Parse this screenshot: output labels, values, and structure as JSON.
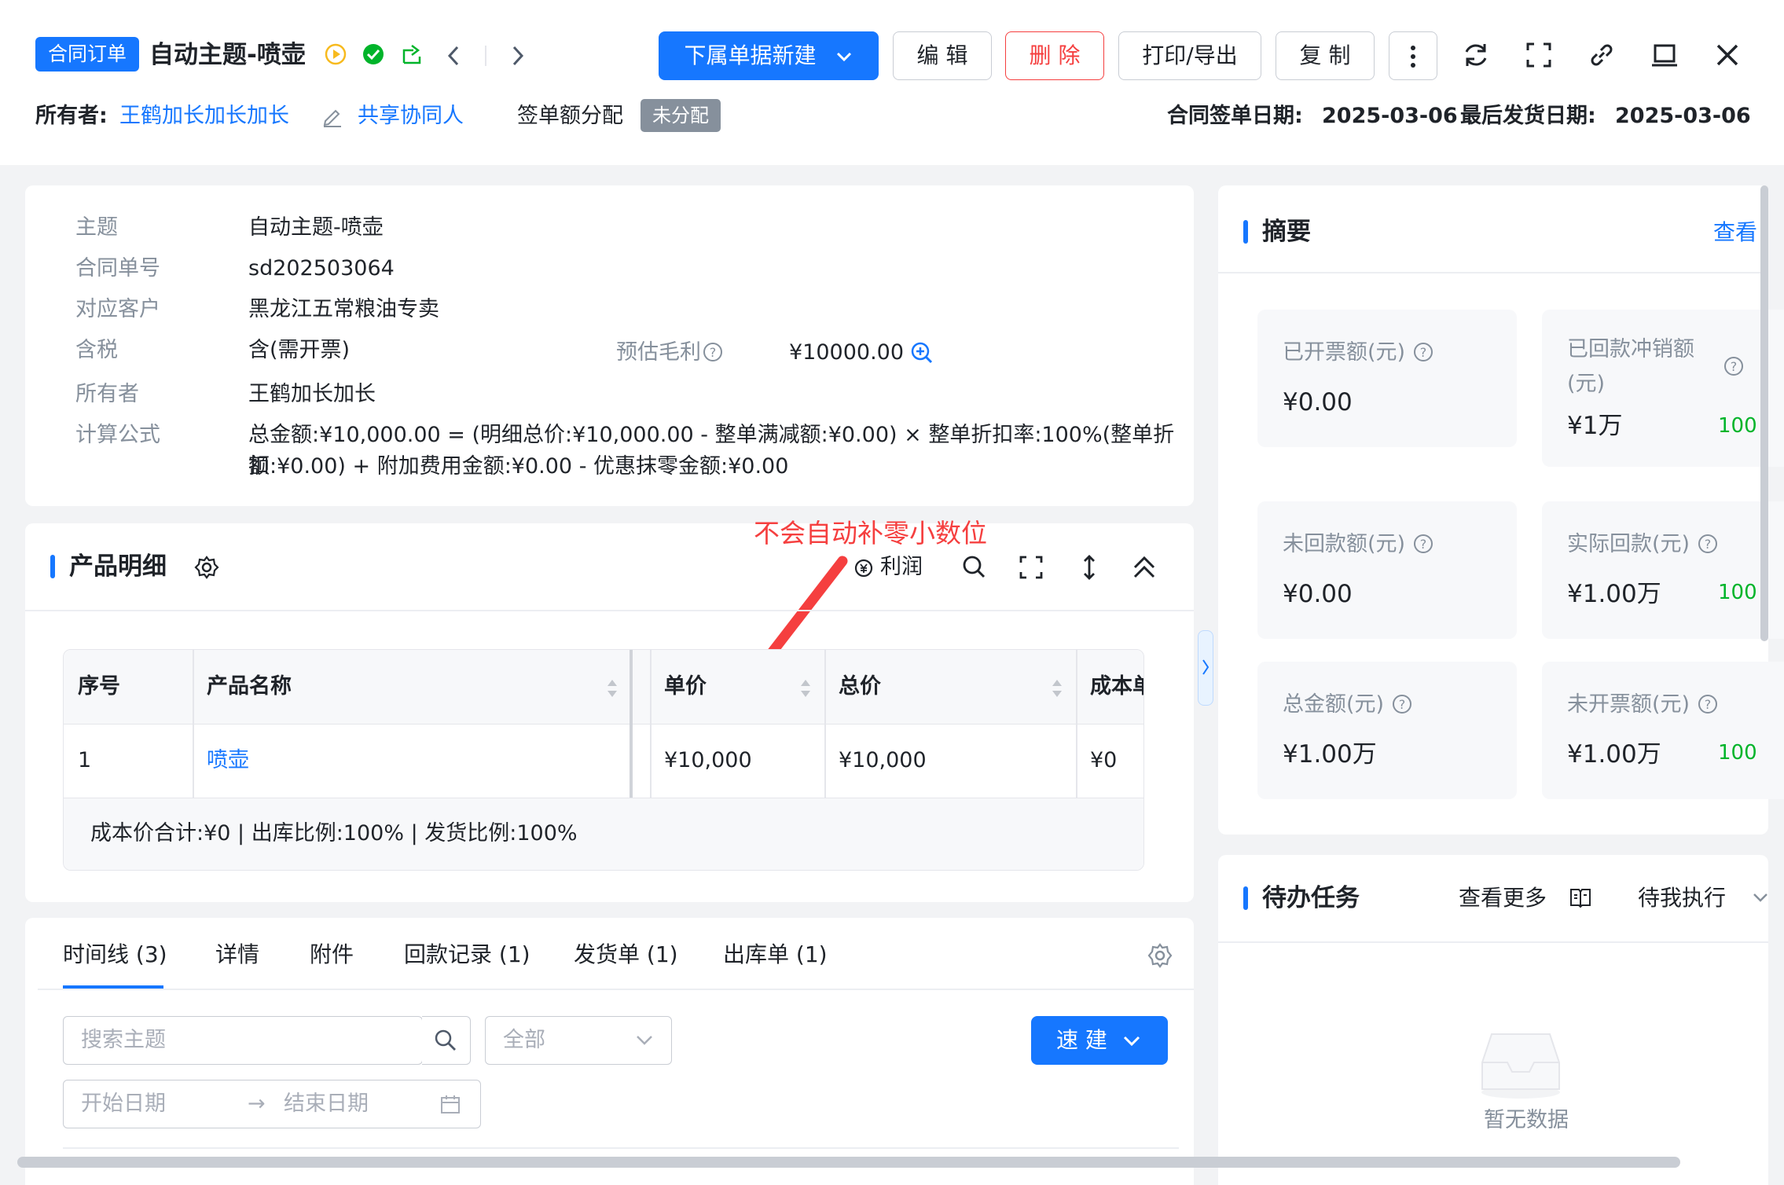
{
  "header": {
    "tag": "合同订单",
    "title": "自动主题-喷壶",
    "buttons": {
      "new_sub": "下属单据新建",
      "edit": "编 辑",
      "delete": "删 除",
      "print": "打印/导出",
      "copy": "复 制"
    },
    "owner_label": "所有者:",
    "owner_value": "王鹤加长加长加长",
    "share_label": "共享协同人",
    "sign_amount_label": "签单额分配",
    "sign_amount_badge": "未分配",
    "sign_date_label": "合同签单日期:",
    "sign_date_value": "2025-03-06",
    "ship_date_label": "最后发货日期:",
    "ship_date_value": "2025-03-06"
  },
  "detail": {
    "fields": [
      {
        "label": "主题",
        "value": "自动主题-喷壶"
      },
      {
        "label": "合同单号",
        "value": "sd202503064"
      },
      {
        "label": "对应客户",
        "value": "黑龙江五常粮油专卖"
      },
      {
        "label": "含税",
        "value": "含(需开票)"
      },
      {
        "label": "所有者",
        "value": "王鹤加长加长"
      },
      {
        "label": "计算公式",
        "value": "总金额:¥10,000.00 = (明细总价:¥10,000.00 - 整单满减额:¥0.00) × 整单折扣率:100%(整单折扣",
        "value2": "额:¥0.00) + 附加费用金额:¥0.00 - 优惠抹零金额:¥0.00"
      }
    ],
    "profit_label": "预估毛利",
    "profit_value": "¥10000.00"
  },
  "products": {
    "title": "产品明细",
    "annotation": "不会自动补零小数位",
    "profit_toggle": "利润",
    "columns": [
      "序号",
      "产品名称",
      "单价",
      "总价",
      "成本单"
    ],
    "rows": [
      {
        "index": "1",
        "name": "喷壶",
        "unit_price": "¥10,000",
        "total": "¥10,000",
        "cost": "¥0"
      }
    ],
    "footer": "成本价合计:¥0 | 出库比例:100% | 发货比例:100%"
  },
  "tabs": {
    "items": [
      "时间线 (3)",
      "详情",
      "附件",
      "回款记录 (1)",
      "发货单 (1)",
      "出库单 (1)"
    ],
    "search_placeholder": "搜索主题",
    "filter_value": "全部",
    "quick_create": "速 建",
    "start_date": "开始日期",
    "end_date": "结束日期"
  },
  "summary": {
    "title": "摘要",
    "view": "查看",
    "cards": [
      {
        "label": "已开票额(元)",
        "value": "¥0.00"
      },
      {
        "label": "已回款冲销额",
        "label2": "(元)",
        "value": "¥1万",
        "pct": "100"
      },
      {
        "label": "未回款额(元)",
        "value": "¥0.00"
      },
      {
        "label": "实际回款(元)",
        "value": "¥1.00万",
        "pct": "100"
      },
      {
        "label": "总金额(元)",
        "value": "¥1.00万"
      },
      {
        "label": "未开票额(元)",
        "value": "¥1.00万",
        "pct": "100"
      }
    ]
  },
  "todo": {
    "title": "待办任务",
    "more": "查看更多",
    "filter": "待我执行",
    "empty": "暂无数据"
  },
  "colors": {
    "primary": "#1677ff",
    "danger": "#f53f3f",
    "annotation": "#f53f3f",
    "green": "#00b42a"
  }
}
